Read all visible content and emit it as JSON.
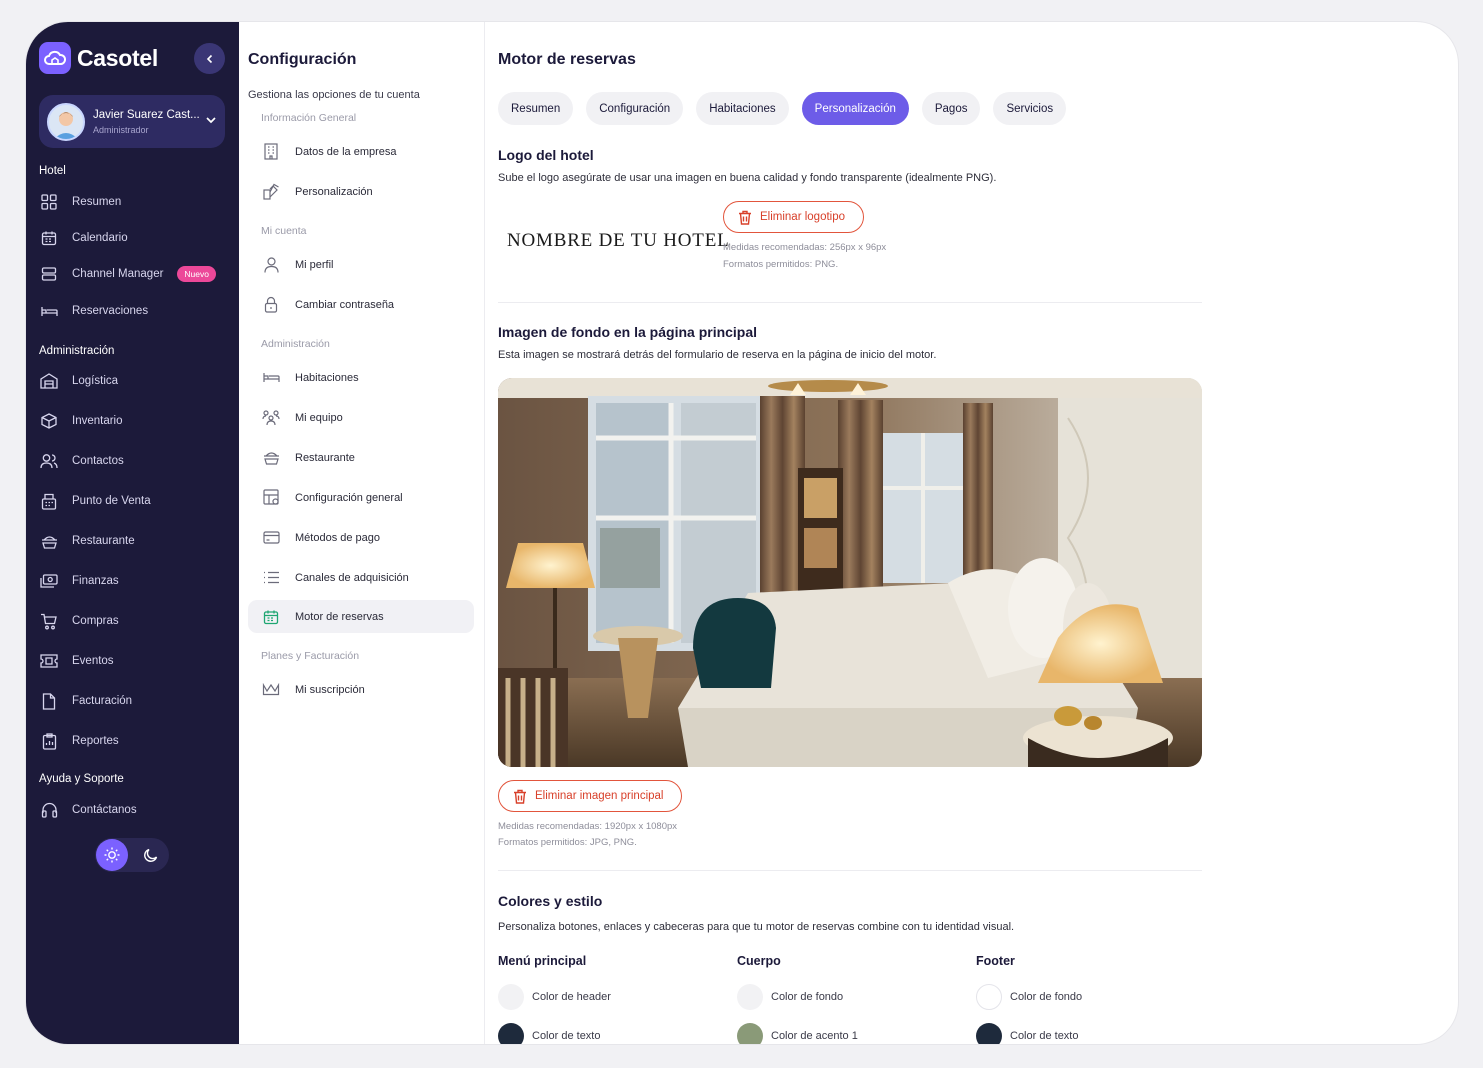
{
  "brand": {
    "name": "Casotel",
    "accent": "#7b61ff",
    "sidebar_bg": "#1c1a3a",
    "danger": "#d8402a"
  },
  "user": {
    "name": "Javier Suarez Cast...",
    "role": "Administrador"
  },
  "sidebar": {
    "sections": [
      {
        "label": "Hotel",
        "items": [
          {
            "label": "Resumen",
            "icon": "grid-icon"
          },
          {
            "label": "Calendario",
            "icon": "calendar-icon"
          },
          {
            "label": "Channel Manager",
            "icon": "server-icon",
            "badge": "Nuevo"
          },
          {
            "label": "Reservaciones",
            "icon": "bed-icon"
          }
        ]
      },
      {
        "label": "Administración",
        "items": [
          {
            "label": "Logística",
            "icon": "warehouse-icon"
          },
          {
            "label": "Inventario",
            "icon": "box-icon"
          },
          {
            "label": "Contactos",
            "icon": "users-icon"
          },
          {
            "label": "Punto de Venta",
            "icon": "pos-icon"
          },
          {
            "label": "Restaurante",
            "icon": "dish-icon"
          },
          {
            "label": "Finanzas",
            "icon": "money-icon"
          },
          {
            "label": "Compras",
            "icon": "cart-icon"
          },
          {
            "label": "Eventos",
            "icon": "ticket-icon"
          },
          {
            "label": "Facturación",
            "icon": "document-icon"
          },
          {
            "label": "Reportes",
            "icon": "clipboard-icon"
          }
        ]
      },
      {
        "label": "Ayuda y Soporte",
        "items": [
          {
            "label": "Contáctanos",
            "icon": "headset-icon"
          }
        ]
      }
    ]
  },
  "config": {
    "title": "Configuración",
    "subtitle": "Gestiona las opciones de tu cuenta",
    "groups": [
      {
        "label": "Información General",
        "items": [
          {
            "label": "Datos de la empresa",
            "icon": "building-icon"
          },
          {
            "label": "Personalización",
            "icon": "palette-icon"
          }
        ]
      },
      {
        "label": "Mi cuenta",
        "items": [
          {
            "label": "Mi perfil",
            "icon": "user-icon"
          },
          {
            "label": "Cambiar contraseña",
            "icon": "lock-icon"
          }
        ]
      },
      {
        "label": "Administración",
        "items": [
          {
            "label": "Habitaciones",
            "icon": "bed-icon"
          },
          {
            "label": "Mi equipo",
            "icon": "team-icon"
          },
          {
            "label": "Restaurante",
            "icon": "dish-icon"
          },
          {
            "label": "Configuración general",
            "icon": "settings-grid-icon"
          },
          {
            "label": "Métodos de pago",
            "icon": "card-icon"
          },
          {
            "label": "Canales de adquisición",
            "icon": "list-icon"
          },
          {
            "label": "Motor de reservas",
            "icon": "calendar-green-icon",
            "active": true
          }
        ]
      },
      {
        "label": "Planes y Facturación",
        "items": [
          {
            "label": "Mi suscripción",
            "icon": "crown-icon"
          }
        ]
      }
    ]
  },
  "main": {
    "title": "Motor de reservas",
    "tabs": [
      "Resumen",
      "Configuración",
      "Habitaciones",
      "Personalización",
      "Pagos",
      "Servicios"
    ],
    "active_tab": "Personalización",
    "logo_section": {
      "title": "Logo del hotel",
      "desc": "Sube el logo asegúrate de usar una imagen en buena calidad y fondo transparente (idealmente PNG).",
      "hotel_name": "NOMBRE DE TU HOTEL",
      "delete_label": "Eliminar logotipo",
      "hint_size": "Medidas recomendadas: 256px x 96px",
      "hint_format": "Formatos permitidos: PNG."
    },
    "bg_section": {
      "title": "Imagen de fondo en la página principal",
      "desc": "Esta imagen se mostrará detrás del formulario de reserva en la página de inicio del motor.",
      "delete_label": "Eliminar imagen principal",
      "hint_size": "Medidas recomendadas: 1920px x 1080px",
      "hint_format": "Formatos permitidos: JPG, PNG."
    },
    "colors_section": {
      "title": "Colores y estilo",
      "desc": "Personaliza botones, enlaces y cabeceras para que tu motor de reservas combine con tu identidad visual.",
      "columns": [
        {
          "title": "Menú principal",
          "swatches": [
            {
              "label": "Color de header",
              "color": "#f2f2f4"
            },
            {
              "label": "Color de texto",
              "color": "#1e2a3c"
            }
          ]
        },
        {
          "title": "Cuerpo",
          "swatches": [
            {
              "label": "Color de fondo",
              "color": "#f2f2f4"
            },
            {
              "label": "Color de acento 1",
              "color": "#8a9a78"
            }
          ]
        },
        {
          "title": "Footer",
          "swatches": [
            {
              "label": "Color de fondo",
              "color": "#ffffff"
            },
            {
              "label": "Color de texto",
              "color": "#1e2a3c"
            }
          ]
        }
      ]
    }
  }
}
